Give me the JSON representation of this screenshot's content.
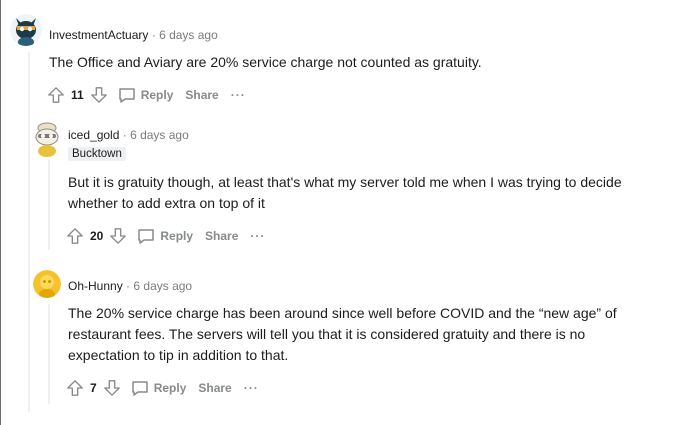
{
  "comments": [
    {
      "author": "InvestmentActuary",
      "separator": "·",
      "time": "6 days ago",
      "flair": "",
      "body_lines": [
        "The Office and Aviary are 20% service charge not counted as gratuity."
      ],
      "score": "11",
      "reply_label": "Reply",
      "share_label": "Share",
      "more_label": "···",
      "avatar": "dark-cat-avatar"
    },
    {
      "author": "iced_gold",
      "separator": "·",
      "time": "6 days ago",
      "flair": "Bucktown",
      "body_lines": [
        "But it is gratuity though, at least that's what my server told me when I was trying to decide",
        "whether to add extra on top of it"
      ],
      "score": "20",
      "reply_label": "Reply",
      "share_label": "Share",
      "more_label": "···",
      "avatar": "snoo-avatar-with-hat"
    },
    {
      "author": "Oh-Hunny",
      "separator": "·",
      "time": "6 days ago",
      "flair": "",
      "body_lines": [
        "The 20% service charge has been around since well before COVID and the “new age” of",
        "restaurant fees. The servers will tell you that it is considered gratuity and there is no",
        "expectation to tip in addition to that."
      ],
      "score": "7",
      "reply_label": "Reply",
      "share_label": "Share",
      "more_label": "···",
      "avatar": "yellow-default-avatar"
    }
  ]
}
